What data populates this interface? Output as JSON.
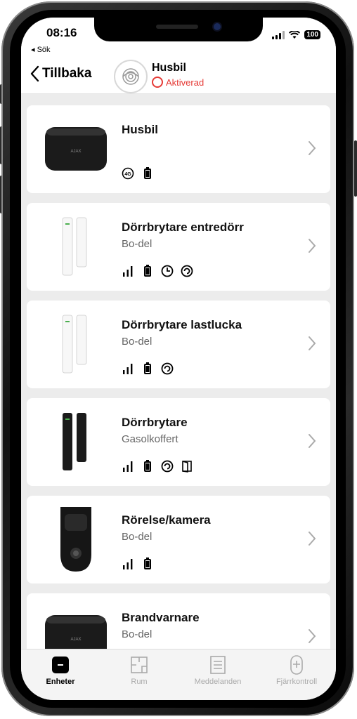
{
  "status_bar": {
    "time": "08:16",
    "back_app": "◂ Sök",
    "battery": "100"
  },
  "header": {
    "back_label": "Tillbaka",
    "hub_name": "Husbil",
    "hub_status": "Aktiverad"
  },
  "devices": [
    {
      "name": "Husbil",
      "room": "",
      "icons": [
        "4g-icon",
        "battery-icon"
      ],
      "image": "hub"
    },
    {
      "name": "Dörrbrytare entredörr",
      "room": "Bo-del",
      "icons": [
        "signal-icon",
        "battery-icon",
        "clock-icon",
        "delay-icon"
      ],
      "image": "door-white"
    },
    {
      "name": "Dörrbrytare lastlucka",
      "room": "Bo-del",
      "icons": [
        "signal-icon",
        "battery-icon",
        "delay-icon"
      ],
      "image": "door-white"
    },
    {
      "name": "Dörrbrytare",
      "room": "Gasolkoffert",
      "icons": [
        "signal-icon",
        "battery-icon",
        "delay-icon",
        "door-icon"
      ],
      "image": "door-black"
    },
    {
      "name": "Rörelse/kamera",
      "room": "Bo-del",
      "icons": [
        "signal-icon",
        "battery-icon"
      ],
      "image": "camera"
    },
    {
      "name": "Brandvarnare",
      "room": "Bo-del",
      "icons": [],
      "image": "hub"
    }
  ],
  "tabs": [
    {
      "label": "Enheter",
      "active": true
    },
    {
      "label": "Rum",
      "active": false
    },
    {
      "label": "Meddelanden",
      "active": false
    },
    {
      "label": "Fjärrkontroll",
      "active": false
    }
  ]
}
